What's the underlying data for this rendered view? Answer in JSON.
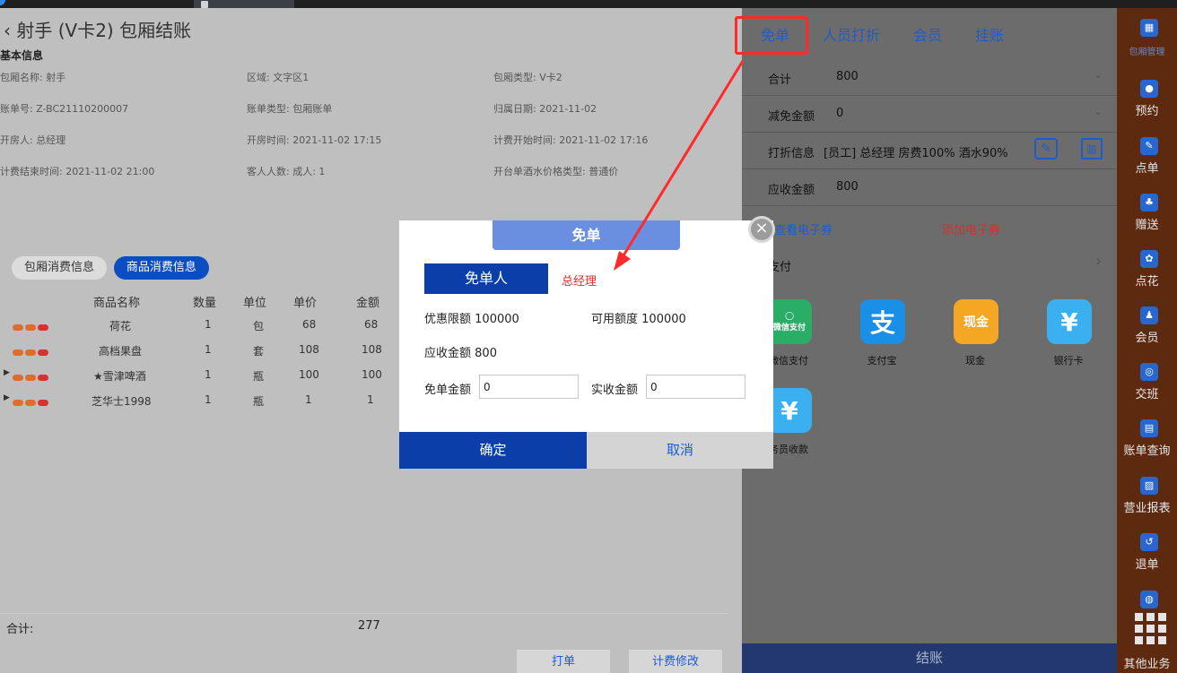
{
  "header": {
    "title": "射手 (V卡2) 包厢结账"
  },
  "basic_info": {
    "heading": "基本信息",
    "fields": [
      {
        "k": "包厢名称: ",
        "v": "射手"
      },
      {
        "k": "区域: ",
        "v": "文字区1"
      },
      {
        "k": "包厢类型: ",
        "v": "V卡2"
      },
      {
        "k": "账单号: ",
        "v": "Z-BC21110200007"
      },
      {
        "k": "账单类型: ",
        "v": "包厢账单"
      },
      {
        "k": "归属日期: ",
        "v": "2021-11-02"
      },
      {
        "k": "开房人: ",
        "v": "总经理"
      },
      {
        "k": "开房时间: ",
        "v": "2021-11-02 17:15"
      },
      {
        "k": "计费开始时间: ",
        "v": "2021-11-02 17:16"
      },
      {
        "k": "计费结束时间: ",
        "v": "2021-11-02 21:00"
      },
      {
        "k": "客人人数: ",
        "v": "成人: 1"
      },
      {
        "k": "开台单酒水价格类型: ",
        "v": "普通价"
      }
    ]
  },
  "consume_tabs": [
    "包厢消费信息",
    "商品消费信息"
  ],
  "goods_table": {
    "columns": [
      "商品名称",
      "数量",
      "单位",
      "单价",
      "金额"
    ],
    "rows": [
      {
        "name": "荷花",
        "qty": "1",
        "unit": "包",
        "price": "68",
        "amount": "68"
      },
      {
        "name": "高档果盘",
        "qty": "1",
        "unit": "套",
        "price": "108",
        "amount": "108"
      },
      {
        "name": "★雪津啤酒",
        "qty": "1",
        "unit": "瓶",
        "price": "100",
        "amount": "100"
      },
      {
        "name": "芝华士1998",
        "qty": "1",
        "unit": "瓶",
        "price": "1",
        "amount": "1"
      }
    ],
    "total_label": "合计:",
    "total_value": "277"
  },
  "bottom_buttons": {
    "print": "打单",
    "fee_edit": "计费修改"
  },
  "right_panel": {
    "tabs": [
      "免单",
      "人员打折",
      "会员",
      "挂账"
    ],
    "total_label": "合计",
    "total_value": "800",
    "reduce_label": "减免金额",
    "reduce_value": "0",
    "discount_label": "打折信息",
    "discount_value": "[员工] 总经理 房费100% 酒水90%",
    "receivable_label": "应收金额",
    "receivable_value": "800",
    "view_coupon": "查看电子券",
    "add_coupon": "添加电子券",
    "payment_title": "支付",
    "payments": [
      {
        "label": "微信支付",
        "icon": "wechat-pay-icon",
        "color": "#2aae67"
      },
      {
        "label": "支付宝",
        "icon": "alipay-icon",
        "color": "#1a8fe8"
      },
      {
        "label": "现金",
        "icon": "cash-icon",
        "color": "#f5a623"
      },
      {
        "label": "银行卡",
        "icon": "bank-card-icon",
        "color": "#3ab0f0"
      },
      {
        "label": "务员收款",
        "icon": "waiter-collect-icon",
        "color": "#3ab0f0"
      }
    ],
    "wechat_badge": "微信支付",
    "cash_badge": "现金",
    "yen": "¥",
    "checkout": "结账"
  },
  "sidebar": {
    "items": [
      "预约",
      "点单",
      "赠送",
      "点花",
      "会员",
      "交班",
      "账单查询",
      "营业报表",
      "退单",
      "其他业务"
    ],
    "top_label": "包厢管理"
  },
  "dialog": {
    "title": "免单",
    "person_chip": "免单人",
    "person_name": "总经理",
    "limit_label": "优惠限额",
    "limit_value": "100000",
    "available_label": "可用额度",
    "available_value": "100000",
    "receivable_label": "应收金额",
    "receivable_value": "800",
    "free_amount_label": "免单金额",
    "free_amount_value": "0",
    "actual_label": "实收金额",
    "actual_value": "0",
    "confirm": "确定",
    "cancel": "取消",
    "close": "×"
  }
}
